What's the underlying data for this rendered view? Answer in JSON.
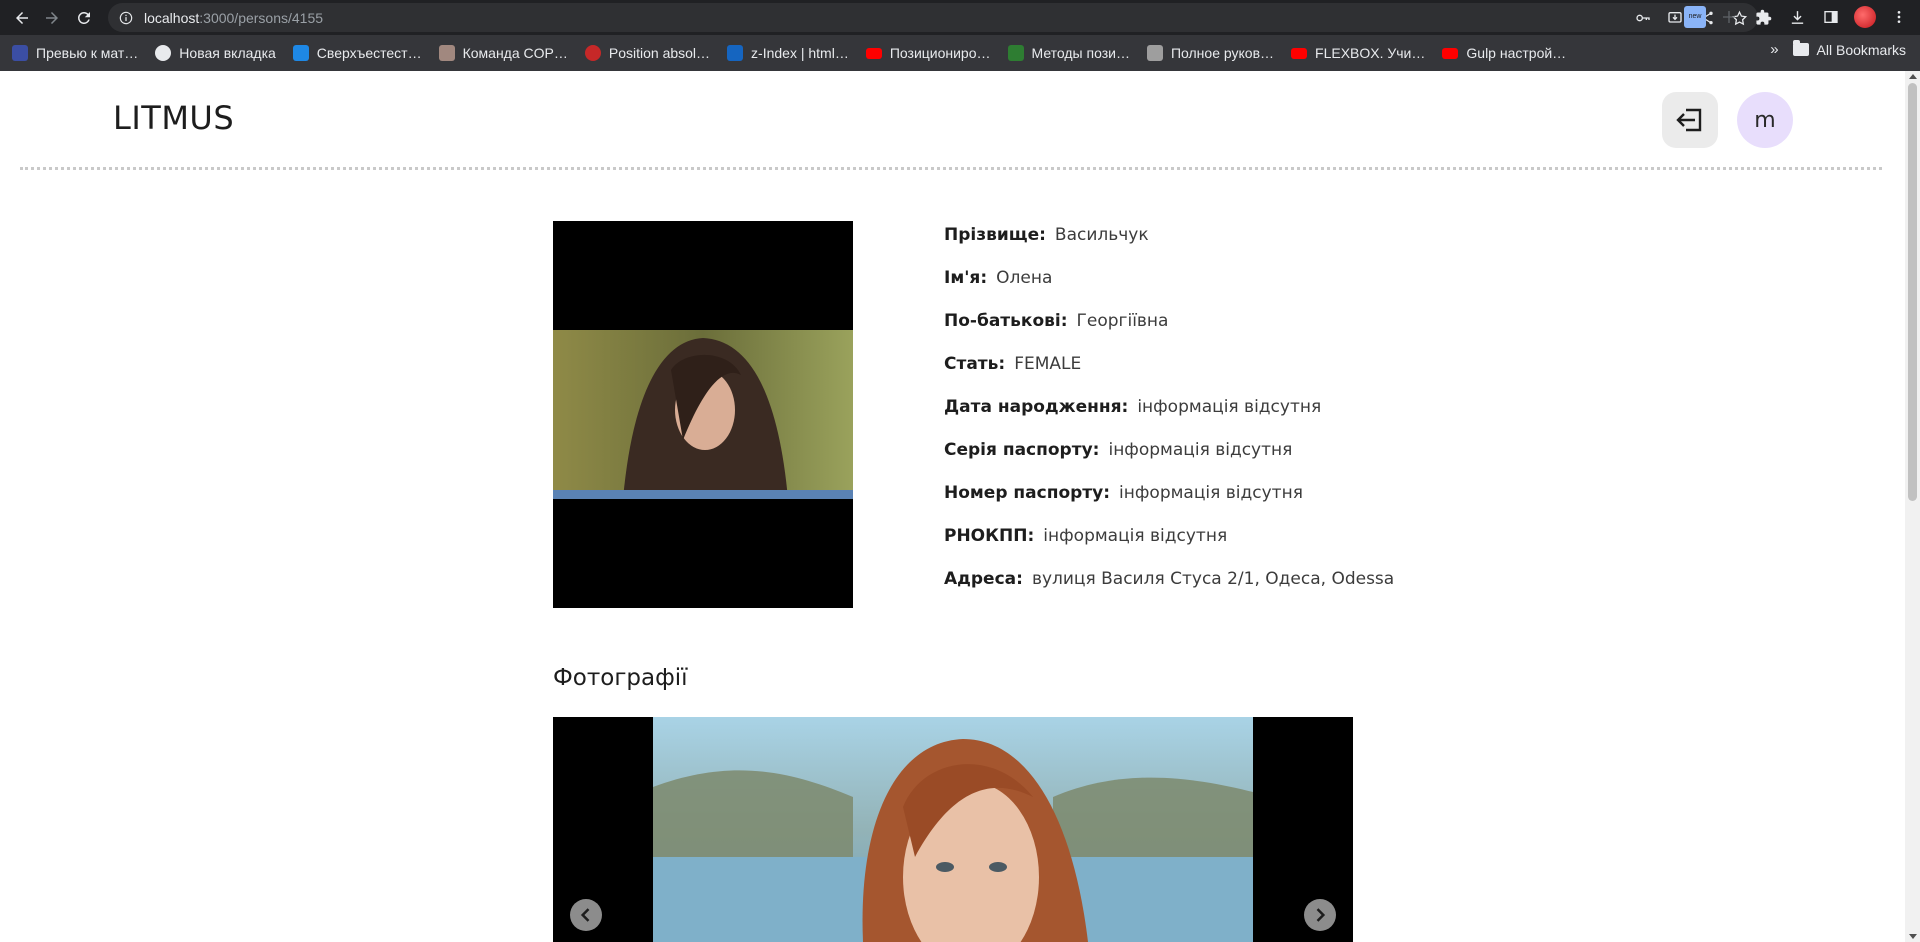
{
  "browser": {
    "url_host": "localhost",
    "url_path": ":3000/persons/4155",
    "ext_badge": "new",
    "bookmarks": [
      {
        "label": "Превью к мат…",
        "color": "#3b4ea3"
      },
      {
        "label": "Новая вкладка",
        "color": "#e8eaed"
      },
      {
        "label": "Сверхъестест…",
        "color": "#1e88e5"
      },
      {
        "label": "Команда COP…",
        "color": "#a1887f"
      },
      {
        "label": "Position absol…",
        "color": "#c62828"
      },
      {
        "label": "z-Index | html…",
        "color": "#1565c0"
      },
      {
        "label": "Позициониро…",
        "color": "#ff0000"
      },
      {
        "label": "Методы пози…",
        "color": "#2e7d32"
      },
      {
        "label": "Полное руков…",
        "color": "#9e9e9e"
      },
      {
        "label": "FLEXBOX. Учи…",
        "color": "#ff0000"
      },
      {
        "label": "Gulp настрой…",
        "color": "#ff0000"
      }
    ],
    "all_bookmarks_label": "All Bookmarks",
    "more_label": "»"
  },
  "header": {
    "logo": "LITMUS",
    "avatar_letter": "m"
  },
  "person": {
    "fields": [
      {
        "label": "Прізвище:",
        "value": "Васильчук"
      },
      {
        "label": "Ім'я:",
        "value": "Олена"
      },
      {
        "label": "По-батькові:",
        "value": "Георгіївна"
      },
      {
        "label": "Стать:",
        "value": "FEMALE"
      },
      {
        "label": "Дата народження:",
        "value": "інформація відсутня"
      },
      {
        "label": "Серія паспорту:",
        "value": "інформація відсутня"
      },
      {
        "label": "Номер паспорту:",
        "value": "інформація відсутня"
      },
      {
        "label": "РНОКПП:",
        "value": "інформація відсутня"
      },
      {
        "label": "Адреса:",
        "value": "вулиця Василя Стуса 2/1, Одеса, Odessa"
      }
    ]
  },
  "photos": {
    "title": "Фотографії"
  },
  "colors": {
    "avatar_bg": "#e8defc",
    "logout_bg": "#ebebeb",
    "chrome_bg": "#202124",
    "bookmarks_bg": "#35363a"
  }
}
